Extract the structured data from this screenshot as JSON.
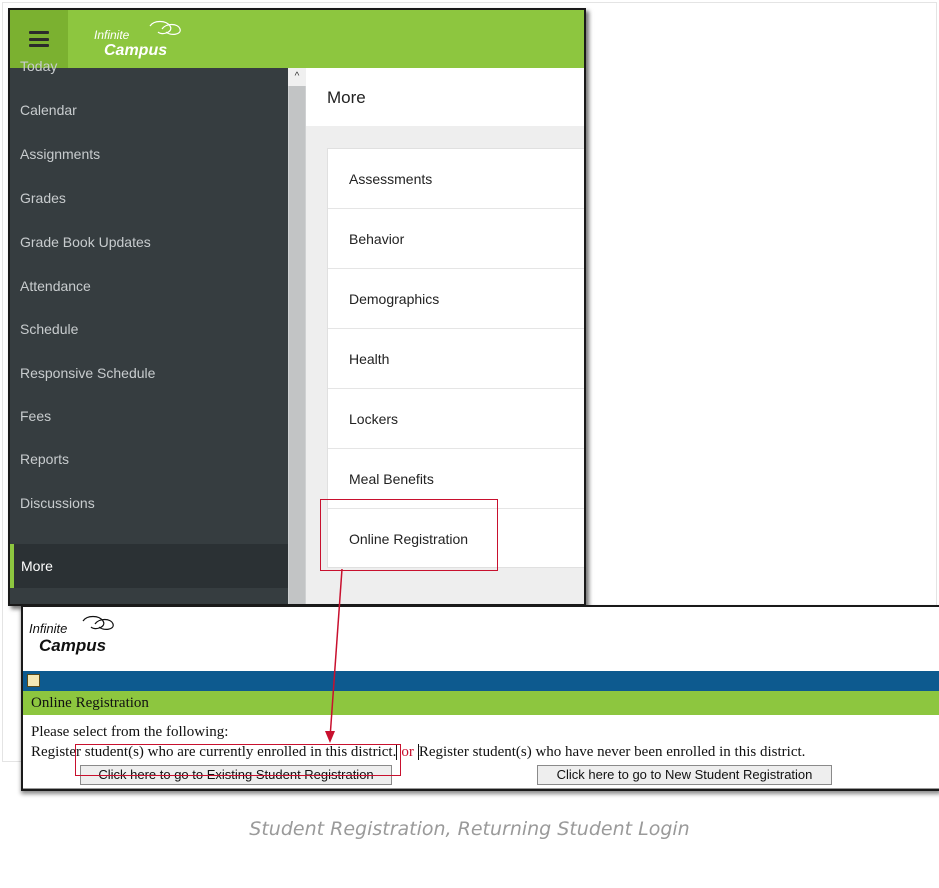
{
  "app": {
    "logo": {
      "line1": "Infinite",
      "line2": "Campus"
    },
    "sidebar": {
      "items": [
        {
          "label": "Today"
        },
        {
          "label": "Calendar"
        },
        {
          "label": "Assignments"
        },
        {
          "label": "Grades"
        },
        {
          "label": "Grade Book Updates"
        },
        {
          "label": "Attendance"
        },
        {
          "label": "Schedule"
        },
        {
          "label": "Responsive Schedule"
        },
        {
          "label": "Fees"
        },
        {
          "label": "Reports"
        },
        {
          "label": "Discussions"
        },
        {
          "label": "More"
        }
      ],
      "active": "More",
      "scroll_up_glyph": "^"
    },
    "content": {
      "title": "More",
      "items": [
        {
          "label": "Assessments"
        },
        {
          "label": "Behavior"
        },
        {
          "label": "Demographics"
        },
        {
          "label": "Health"
        },
        {
          "label": "Lockers"
        },
        {
          "label": "Meal Benefits"
        },
        {
          "label": "Online Registration"
        }
      ]
    },
    "colors": {
      "header_green": "#8dc63f",
      "sidebar_dark": "#363d40",
      "highlight_red": "#c8102e"
    }
  },
  "legacy": {
    "logo": {
      "line1": "Infinite",
      "line2": "Campus"
    },
    "page_title": "Online Registration",
    "prompt": "Please select from the following:",
    "existing_text": "Register student(s) who are currently enrolled in this district.",
    "or_text": "or",
    "new_text": "Register student(s) who have never been enrolled in this district.",
    "existing_button": "Click here to go to Existing Student Registration",
    "new_button": "Click here to go to New Student Registration",
    "colors": {
      "blue_bar": "#0d5a8f",
      "green_bar": "#8dc63f"
    }
  },
  "caption": "Student Registration, Returning Student Login"
}
